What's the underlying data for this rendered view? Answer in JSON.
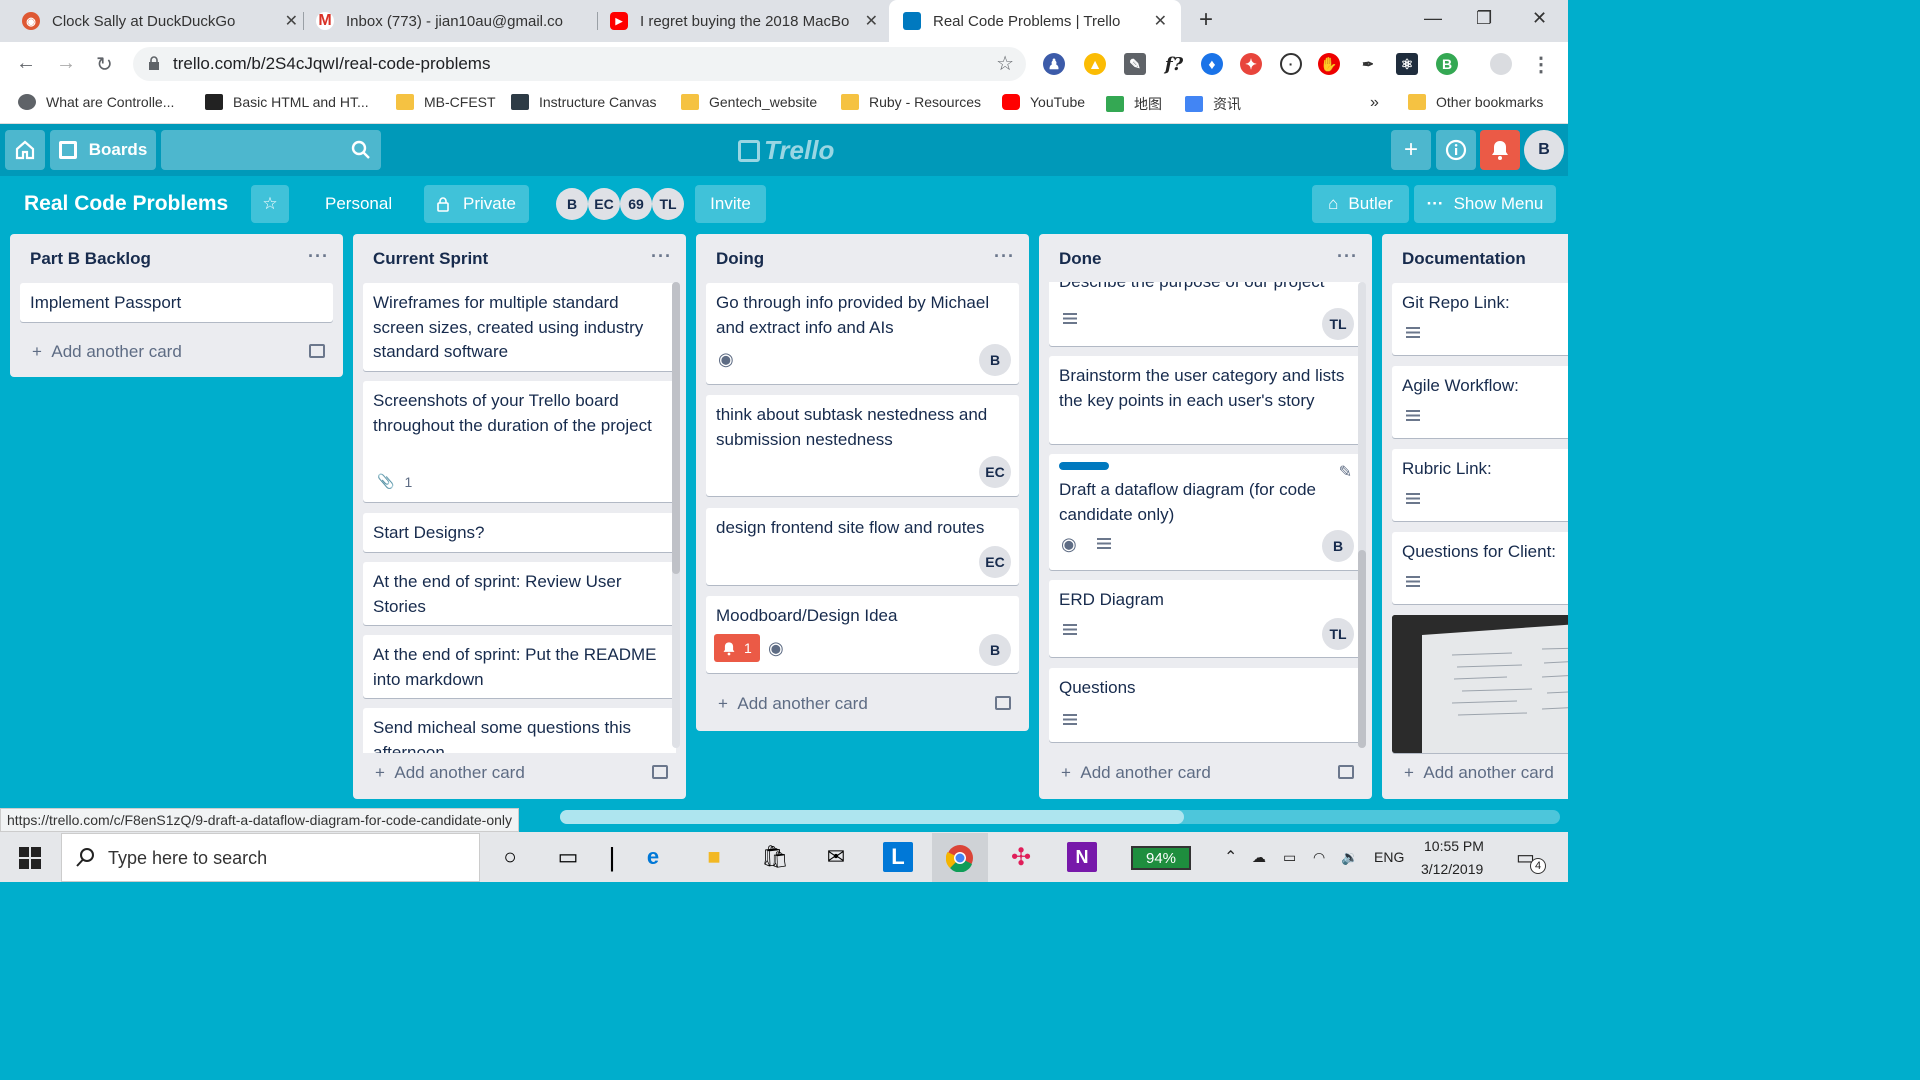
{
  "browser": {
    "tabs": [
      {
        "title": "Clock Sally at DuckDuckGo",
        "icon": "duckduckgo-icon"
      },
      {
        "title": "Inbox (773) - jian10au@gmail.co",
        "icon": "gmail-icon"
      },
      {
        "title": "I regret buying the 2018 MacBo",
        "icon": "youtube-icon"
      },
      {
        "title": "Real Code Problems | Trello",
        "icon": "trello-icon"
      }
    ],
    "url": "trello.com/b/2S4cJqwI/real-code-problems",
    "extensions_text": "f?",
    "bookmarks": [
      {
        "label": "What are Controlle...",
        "icon": "globe-icon"
      },
      {
        "label": "Basic HTML and HT...",
        "icon": "code-icon"
      },
      {
        "label": "MB-CFEST",
        "icon": "folder-icon"
      },
      {
        "label": "Instructure Canvas",
        "icon": "canvas-icon"
      },
      {
        "label": "Gentech_website",
        "icon": "folder-icon"
      },
      {
        "label": "Ruby - Resources",
        "icon": "folder-icon"
      },
      {
        "label": "YouTube",
        "icon": "youtube-icon"
      },
      {
        "label": "地图",
        "icon": "maps-icon"
      },
      {
        "label": "资讯",
        "icon": "news-icon"
      }
    ],
    "overflow": "»",
    "other_bookmarks": "Other bookmarks",
    "status_url": "https://trello.com/c/F8enS1zQ/9-draft-a-dataflow-diagram-for-code-candidate-only"
  },
  "header": {
    "boards_label": "Boards",
    "logo": "Trello",
    "user_initial": "B"
  },
  "board": {
    "title": "Real Code Problems",
    "team": "Personal",
    "visibility": "Private",
    "members": [
      "B",
      "EC",
      "69",
      "TL"
    ],
    "invite": "Invite",
    "butler": "Butler",
    "show_menu": "Show Menu"
  },
  "add_card_label": "Add another card",
  "lists": [
    {
      "title": "Part B Backlog",
      "cards": [
        {
          "text": "Implement Passport"
        }
      ]
    },
    {
      "title": "Current Sprint",
      "cards": [
        {
          "text": "Wireframes for multiple standard screen sizes, created using industry standard software"
        },
        {
          "text": "Screenshots of your Trello board throughout the duration of the project",
          "attachments": "1"
        },
        {
          "text": "Start Designs?"
        },
        {
          "text": "At the end of sprint: Review User Stories"
        },
        {
          "text": "At the end of sprint: Put the README into markdown"
        },
        {
          "text": "Send micheal some questions this afternoon"
        }
      ]
    },
    {
      "title": "Doing",
      "cards": [
        {
          "text": "Go through info provided by Michael and extract info and AIs",
          "member": "B"
        },
        {
          "text": "think about subtask nestedness and submission nestedness",
          "member": "EC"
        },
        {
          "text": "design frontend site flow and routes",
          "member": "EC"
        },
        {
          "text": "Moodboard/Design Idea",
          "notifications": "1",
          "member": "B"
        }
      ]
    },
    {
      "title": "Done",
      "cards": [
        {
          "text": "Describe the purpose of our project",
          "member": "TL"
        },
        {
          "text": "Brainstorm the user category and lists the key points in each user's story"
        },
        {
          "text": "Draft a dataflow diagram (for code candidate only)",
          "member": "B",
          "label_color": "#0079bf"
        },
        {
          "text": "ERD Diagram",
          "member": "TL"
        },
        {
          "text": "Questions"
        }
      ]
    },
    {
      "title": "Documentation",
      "cards": [
        {
          "text": "Git Repo Link:"
        },
        {
          "text": "Agile Workflow:"
        },
        {
          "text": "Rubric Link:"
        },
        {
          "text": "Questions for Client:"
        }
      ]
    }
  ],
  "taskbar": {
    "search_placeholder": "Type here to search",
    "battery": "94%",
    "lang": "ENG",
    "time": "10:55 PM",
    "date": "3/12/2019",
    "notifications": "4"
  },
  "colors": {
    "board_bg": "#00aecc",
    "header_bg": "#0099b9",
    "notification_red": "#eb5a46",
    "label_blue": "#0079bf"
  }
}
